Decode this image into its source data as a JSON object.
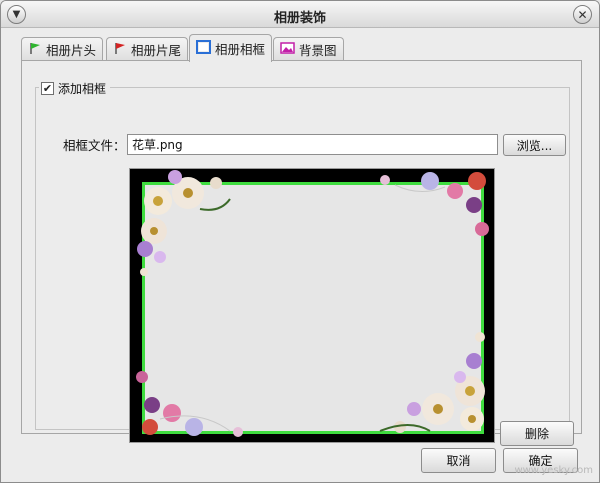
{
  "window": {
    "title": "相册装饰"
  },
  "tabs": [
    {
      "label": "相册片头",
      "icon": "green-flag-icon"
    },
    {
      "label": "相册片尾",
      "icon": "red-flag-icon"
    },
    {
      "label": "相册相框",
      "icon": "frame-icon",
      "active": true
    },
    {
      "label": "背景图",
      "icon": "picture-icon"
    }
  ],
  "frame_panel": {
    "add_frame_label": "添加相框",
    "add_frame_checked": true,
    "file_label": "相框文件：",
    "file_value": "花草.png",
    "browse_label": "浏览...",
    "delete_label": "删除"
  },
  "footer": {
    "cancel_label": "取消",
    "ok_label": "确定"
  },
  "watermark": "www.yesky.com",
  "colors": {
    "frame_border": "#3fdc3f",
    "frame_background": "#000000",
    "frame_inner": "#e6e6e6"
  }
}
